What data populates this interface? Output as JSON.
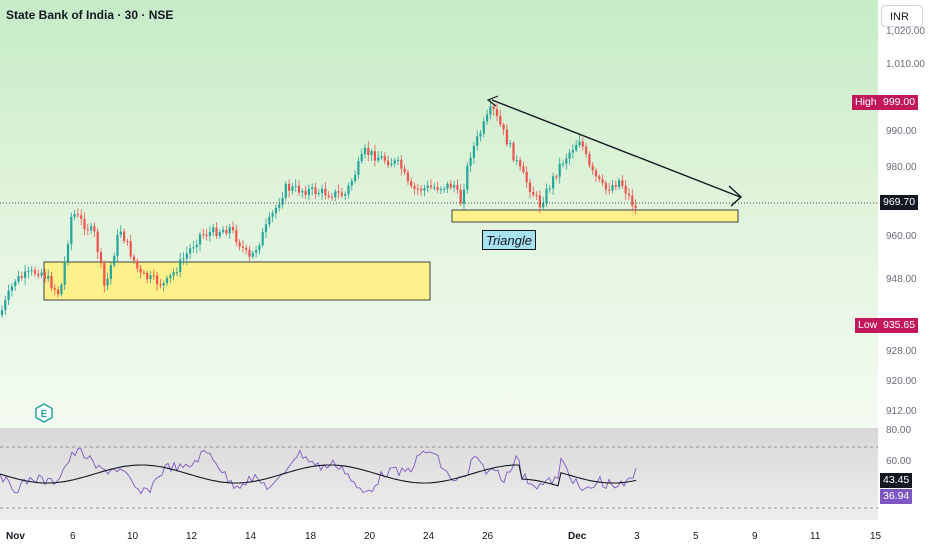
{
  "header": {
    "symbol": "State Bank of India · 30 · NSE",
    "currency": "INR"
  },
  "price_axis": {
    "ticks": [
      "1,020.00",
      "1,010.00",
      "990.00",
      "980.00",
      "960.00",
      "948.00",
      "928.00",
      "920.00",
      "912.00"
    ]
  },
  "rsi_axis": {
    "ticks": [
      "80.00",
      "60.00"
    ]
  },
  "time_axis": {
    "labels": [
      "Nov",
      "6",
      "10",
      "12",
      "14",
      "18",
      "20",
      "24",
      "26",
      "Dec",
      "3",
      "5",
      "9",
      "11",
      "15"
    ]
  },
  "markers": {
    "high_label": "High",
    "high_value": "999.00",
    "low_label": "Low",
    "low_value": "935.65",
    "last_price": "969.70",
    "rsi_ma_value": "43.45",
    "rsi_value": "36.94"
  },
  "annotations": {
    "pattern_label": "Triangle"
  },
  "colors": {
    "up": "#26a69a",
    "down": "#ef5350",
    "high_tag": "#c2185b",
    "low_tag": "#c2185b",
    "last_tag": "#131722",
    "zone": "#fef08a",
    "rsi_line": "#7e57c2",
    "rsi_ma": "#131722"
  },
  "icons": {
    "logo": "e-logo-icon"
  }
}
